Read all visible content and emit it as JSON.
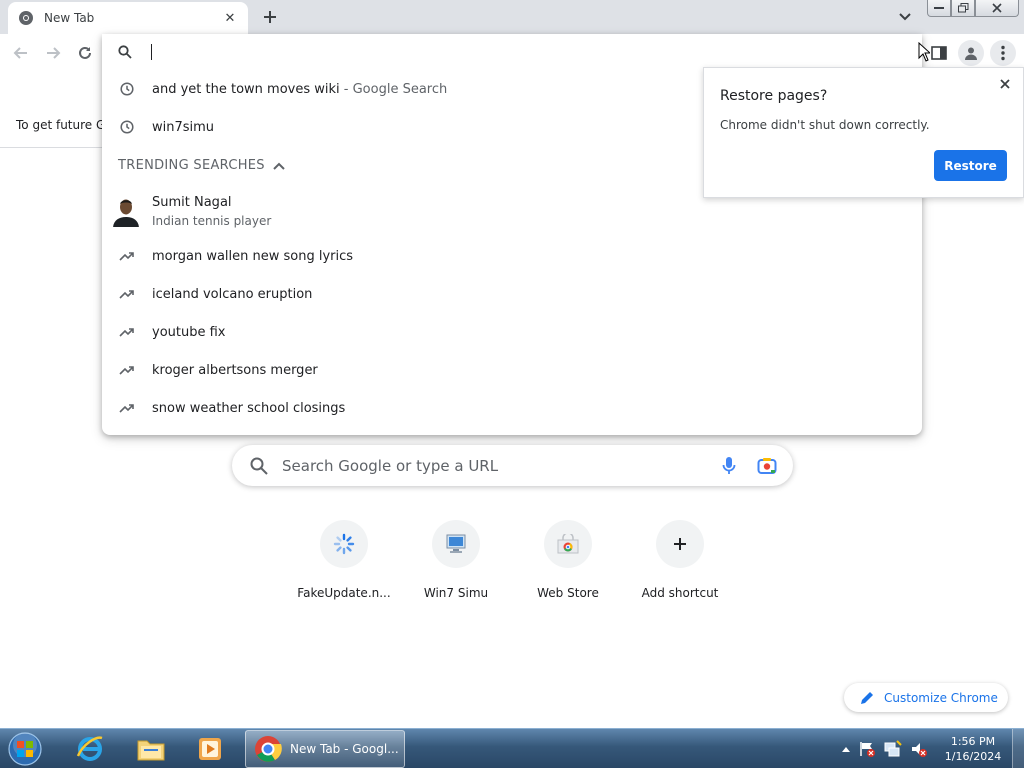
{
  "tab": {
    "title": "New Tab",
    "close_label": "✕",
    "new_tab_label": "+"
  },
  "infobar": {
    "text": "To get future G"
  },
  "omnibox": {
    "history": [
      {
        "text": "and yet the town moves wiki",
        "suffix": "Google Search"
      },
      {
        "text": "win7simu",
        "suffix": ""
      }
    ],
    "trending_header": "TRENDING SEARCHES",
    "person": {
      "name": "Sumit Nagal",
      "description": "Indian tennis player"
    },
    "trending": [
      "morgan wallen new song lyrics",
      "iceland volcano eruption",
      "youtube fix",
      "kroger albertsons merger",
      "snow weather school closings"
    ]
  },
  "restore_bubble": {
    "title": "Restore pages?",
    "message": "Chrome didn't shut down correctly.",
    "button": "Restore"
  },
  "search_box": {
    "placeholder": "Search Google or type a URL"
  },
  "shortcuts": [
    {
      "label": "FakeUpdate.n...",
      "icon": "loading-spinner-icon"
    },
    {
      "label": "Win7 Simu",
      "icon": "win7-computer-icon"
    },
    {
      "label": "Web Store",
      "icon": "chrome-web-store-icon"
    },
    {
      "label": "Add shortcut",
      "icon": "plus-icon"
    }
  ],
  "customize": {
    "label": "Customize Chrome"
  },
  "taskbar": {
    "task_label": "New Tab - Googl...",
    "time": "1:56 PM",
    "date": "1/16/2024"
  },
  "colors": {
    "accent": "#1a73e8",
    "tabstrip": "#dee1e6",
    "taskbar": "#36587a"
  }
}
